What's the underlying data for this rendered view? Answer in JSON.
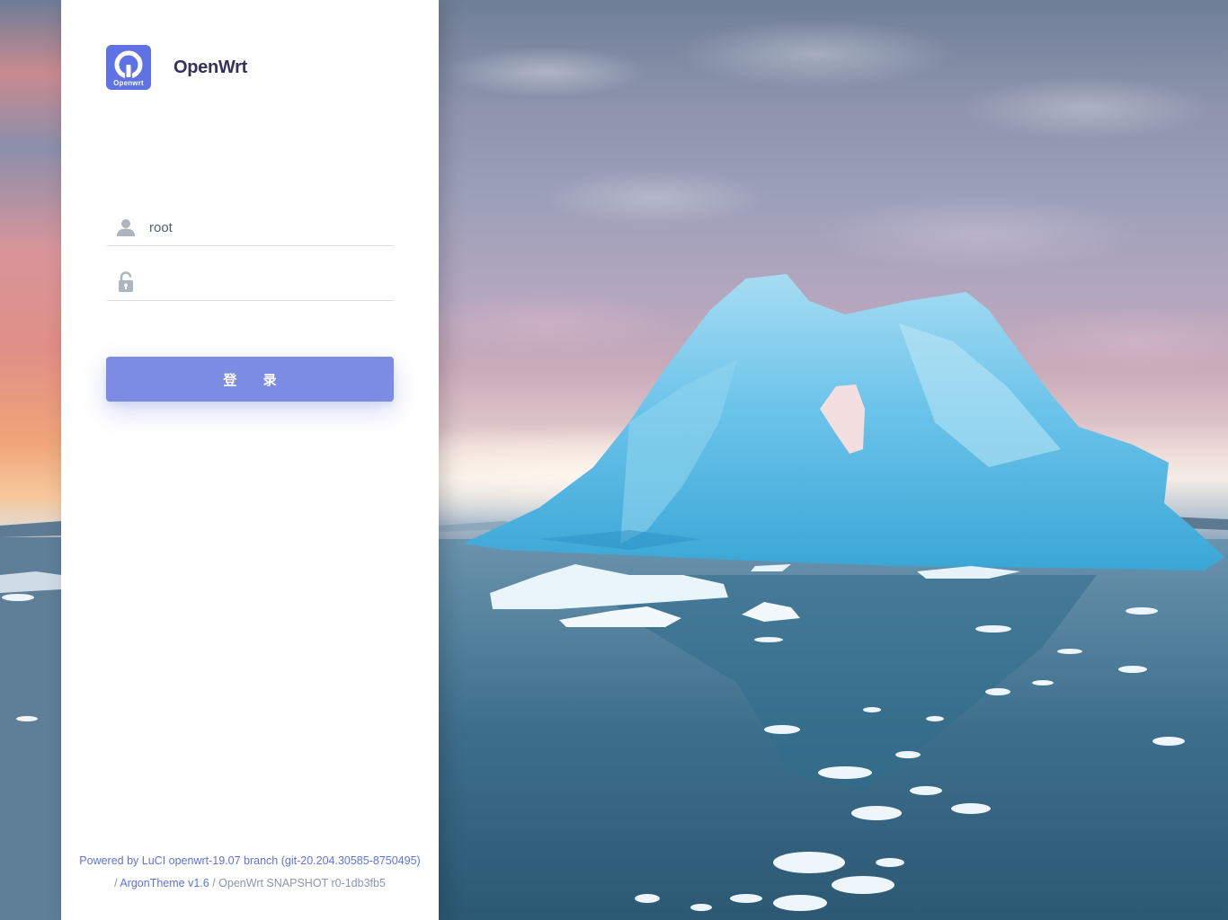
{
  "brand": {
    "logo_text": "Openwrt",
    "name": "OpenWrt"
  },
  "login": {
    "username_value": "root",
    "password_value": "",
    "submit_label": "登 录"
  },
  "footer": {
    "line1_link": "Powered by LuCI openwrt-19.07 branch (git-20.204.30585-8750495)",
    "line2_sep1": "/",
    "line2_link": "ArgonTheme v1.6",
    "line2_sep2": "/",
    "line2_text": "OpenWrt SNAPSHOT r0-1db3fb5"
  },
  "colors": {
    "primary": "#5e72e4",
    "button": "#7c8ce2",
    "heading": "#32325d",
    "muted": "#8898aa"
  },
  "icons": {
    "user": "user-icon",
    "password": "unlock-icon",
    "logo": "openwrt-logo-icon"
  }
}
